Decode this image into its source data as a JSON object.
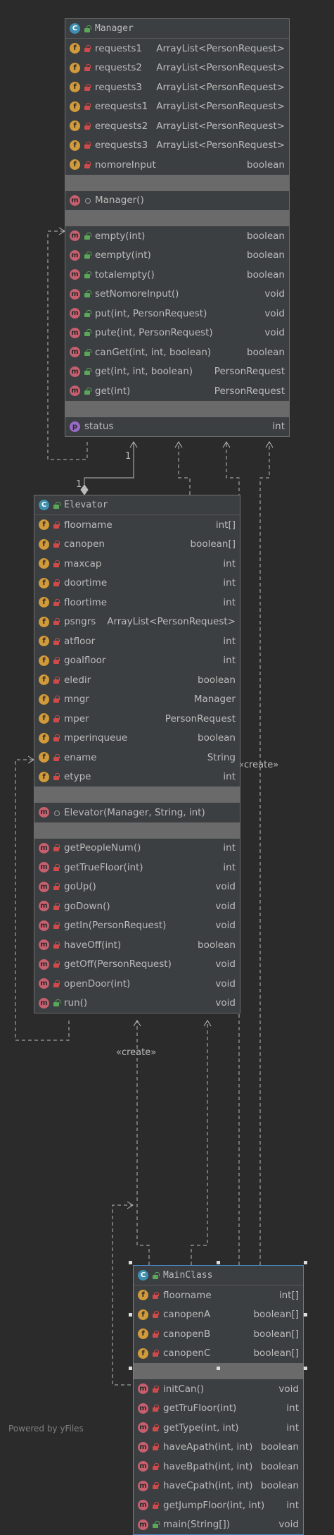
{
  "classes": {
    "manager": {
      "name": "Manager",
      "fields": [
        {
          "name": "requests1",
          "type": "ArrayList<PersonRequest>"
        },
        {
          "name": "requests2",
          "type": "ArrayList<PersonRequest>"
        },
        {
          "name": "requests3",
          "type": "ArrayList<PersonRequest>"
        },
        {
          "name": "erequests1",
          "type": "ArrayList<PersonRequest>"
        },
        {
          "name": "erequests2",
          "type": "ArrayList<PersonRequest>"
        },
        {
          "name": "erequests3",
          "type": "ArrayList<PersonRequest>"
        },
        {
          "name": "nomoreInput",
          "type": "boolean"
        }
      ],
      "constructors": [
        {
          "name": "Manager()",
          "type": ""
        }
      ],
      "methods": [
        {
          "name": "empty(int)",
          "type": "boolean"
        },
        {
          "name": "eempty(int)",
          "type": "boolean"
        },
        {
          "name": "totalempty()",
          "type": "boolean"
        },
        {
          "name": "setNomoreInput()",
          "type": "void"
        },
        {
          "name": "put(int, PersonRequest)",
          "type": "void"
        },
        {
          "name": "pute(int, PersonRequest)",
          "type": "void"
        },
        {
          "name": "canGet(int, int, boolean)",
          "type": "boolean"
        },
        {
          "name": "get(int, int, boolean)",
          "type": "PersonRequest"
        },
        {
          "name": "get(int)",
          "type": "PersonRequest"
        }
      ],
      "properties": [
        {
          "name": "status",
          "type": "int"
        }
      ]
    },
    "elevator": {
      "name": "Elevator",
      "fields": [
        {
          "name": "floorname",
          "type": "int[]"
        },
        {
          "name": "canopen",
          "type": "boolean[]"
        },
        {
          "name": "maxcap",
          "type": "int"
        },
        {
          "name": "doortime",
          "type": "int"
        },
        {
          "name": "floortime",
          "type": "int"
        },
        {
          "name": "psngrs",
          "type": "ArrayList<PersonRequest>"
        },
        {
          "name": "atfloor",
          "type": "int"
        },
        {
          "name": "goalfloor",
          "type": "int"
        },
        {
          "name": "eledir",
          "type": "boolean"
        },
        {
          "name": "mngr",
          "type": "Manager"
        },
        {
          "name": "mper",
          "type": "PersonRequest"
        },
        {
          "name": "mperinqueue",
          "type": "boolean"
        },
        {
          "name": "ename",
          "type": "String"
        },
        {
          "name": "etype",
          "type": "int"
        }
      ],
      "constructors": [
        {
          "name": "Elevator(Manager, String, int)",
          "type": ""
        }
      ],
      "methods": [
        {
          "name": "getPeopleNum()",
          "type": "int"
        },
        {
          "name": "getTrueFloor(int)",
          "type": "int"
        },
        {
          "name": "goUp()",
          "type": "void"
        },
        {
          "name": "goDown()",
          "type": "void"
        },
        {
          "name": "getIn(PersonRequest)",
          "type": "void"
        },
        {
          "name": "haveOff(int)",
          "type": "boolean"
        },
        {
          "name": "getOff(PersonRequest)",
          "type": "void"
        },
        {
          "name": "openDoor(int)",
          "type": "void"
        },
        {
          "name": "run()",
          "type": "void"
        }
      ]
    },
    "mainclass": {
      "name": "MainClass",
      "fields": [
        {
          "name": "floorname",
          "type": "int[]"
        },
        {
          "name": "canopenA",
          "type": "boolean[]"
        },
        {
          "name": "canopenB",
          "type": "boolean[]"
        },
        {
          "name": "canopenC",
          "type": "boolean[]"
        }
      ],
      "methods": [
        {
          "name": "initCan()",
          "type": "void"
        },
        {
          "name": "getTruFloor(int)",
          "type": "int"
        },
        {
          "name": "getType(int, int)",
          "type": "int"
        },
        {
          "name": "haveApath(int, int)",
          "type": "boolean"
        },
        {
          "name": "haveBpath(int, int)",
          "type": "boolean"
        },
        {
          "name": "haveCpath(int, int)",
          "type": "boolean"
        },
        {
          "name": "getJumpFloor(int, int)",
          "type": "int"
        },
        {
          "name": "main(String[])",
          "type": "void"
        }
      ]
    }
  },
  "edges": {
    "create_label_1": "«create»",
    "create_label_2": "«create»",
    "mult_1": "1",
    "mult_2": "1"
  },
  "watermark": "Powered by yFiles",
  "colors": {
    "background": "#2b2b2b",
    "class_fill": "#3c3f41",
    "field_icon": "#d19a3a",
    "method_icon": "#c65f6e",
    "property_icon": "#9b6ac8",
    "class_icon": "#3d8fb0",
    "selected_border": "#4a88c7"
  }
}
